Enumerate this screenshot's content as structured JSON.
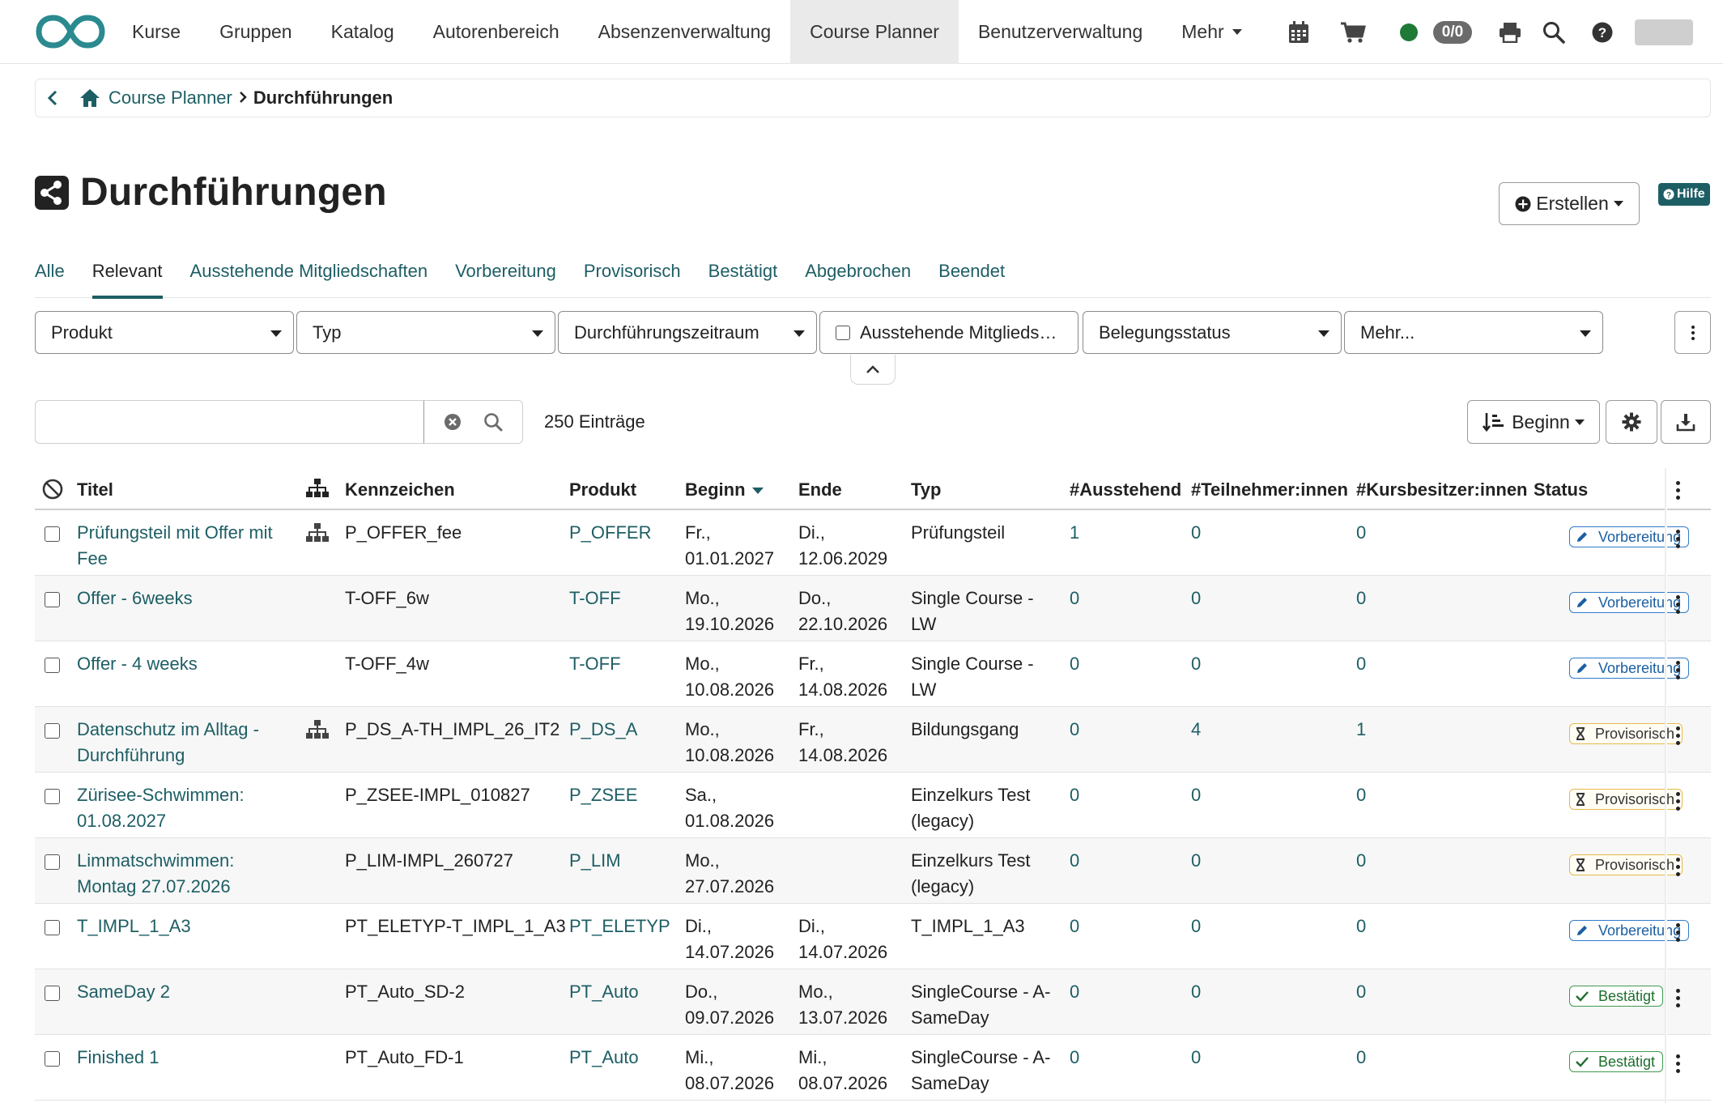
{
  "nav": {
    "items": [
      {
        "label": "Kurse"
      },
      {
        "label": "Gruppen"
      },
      {
        "label": "Katalog"
      },
      {
        "label": "Autorenbereich"
      },
      {
        "label": "Absenzenverwaltung"
      },
      {
        "label": "Course Planner",
        "active": true
      },
      {
        "label": "Benutzerverwaltung"
      },
      {
        "label": "Mehr",
        "dropdown": true
      }
    ],
    "tools": {
      "calendar_icon": "calendar-icon",
      "cart_icon": "cart-icon",
      "online_status_color": "#1e7a36",
      "counter": "0/0",
      "print_icon": "print-icon",
      "search_icon": "search-icon",
      "help_icon": "help-icon"
    }
  },
  "breadcrumb": {
    "home": "Course Planner",
    "current": "Durchführungen"
  },
  "page": {
    "title": "Durchführungen",
    "create_label": "Erstellen",
    "help_label": "Hilfe"
  },
  "tabs": [
    {
      "label": "Alle"
    },
    {
      "label": "Relevant",
      "active": true
    },
    {
      "label": "Ausstehende Mitgliedschaften"
    },
    {
      "label": "Vorbereitung"
    },
    {
      "label": "Provisorisch"
    },
    {
      "label": "Bestätigt"
    },
    {
      "label": "Abgebrochen"
    },
    {
      "label": "Beendet"
    }
  ],
  "filters": {
    "produkt": "Produkt",
    "typ": "Typ",
    "zeitraum": "Durchführungszeitraum",
    "ausstehend": "Ausstehende Mitglieds…",
    "belegung": "Belegungsstatus",
    "mehr": "Mehr..."
  },
  "search": {
    "value": "",
    "entries": "250 Einträge",
    "sort_label": "Beginn"
  },
  "table": {
    "headers": {
      "titel": "Titel",
      "kennzeichen": "Kennzeichen",
      "produkt": "Produkt",
      "beginn": "Beginn",
      "ende": "Ende",
      "typ": "Typ",
      "ausstehend": "#Ausstehend",
      "teilnehmer": "#Teilnehmer:innen",
      "kursbesitzer": "#Kursbesitzer:innen",
      "status": "Status"
    },
    "rows": [
      {
        "t1": "Prüfungsteil mit Offer mit",
        "t2": "Fee",
        "tree": true,
        "kennzeichen": "P_OFFER_fee",
        "produkt": "P_OFFER",
        "b1": "Fr.,",
        "b2": "01.01.2027",
        "e1": "Di.,",
        "e2": "12.06.2029",
        "ty1": "Prüfungsteil",
        "ty2": "",
        "ausstehend": "1",
        "teilnehmer": "0",
        "kursbesitzer": "0",
        "status": "Vorbereitung",
        "status_kind": "prep"
      },
      {
        "t1": "Offer - 6weeks",
        "t2": "",
        "tree": false,
        "kennzeichen": "T-OFF_6w",
        "produkt": "T-OFF",
        "b1": "Mo.,",
        "b2": "19.10.2026",
        "e1": "Do.,",
        "e2": "22.10.2026",
        "ty1": "Single Course -",
        "ty2": "LW",
        "ausstehend": "0",
        "teilnehmer": "0",
        "kursbesitzer": "0",
        "status": "Vorbereitung",
        "status_kind": "prep"
      },
      {
        "t1": "Offer - 4 weeks",
        "t2": "",
        "tree": false,
        "kennzeichen": "T-OFF_4w",
        "produkt": "T-OFF",
        "b1": "Mo.,",
        "b2": "10.08.2026",
        "e1": "Fr.,",
        "e2": "14.08.2026",
        "ty1": "Single Course -",
        "ty2": "LW",
        "ausstehend": "0",
        "teilnehmer": "0",
        "kursbesitzer": "0",
        "status": "Vorbereitung",
        "status_kind": "prep"
      },
      {
        "t1": "Datenschutz im Alltag -",
        "t2": "Durchführung",
        "tree": true,
        "kennzeichen": "P_DS_A-TH_IMPL_26_IT2",
        "produkt": "P_DS_A",
        "b1": "Mo.,",
        "b2": "10.08.2026",
        "e1": "Fr.,",
        "e2": "14.08.2026",
        "ty1": "Bildungsgang",
        "ty2": "",
        "ausstehend": "0",
        "teilnehmer": "4",
        "kursbesitzer": "1",
        "status": "Provisorisch",
        "status_kind": "prov"
      },
      {
        "t1": "Zürisee-Schwimmen:",
        "t2": "01.08.2027",
        "tree": false,
        "kennzeichen": "P_ZSEE-IMPL_010827",
        "produkt": "P_ZSEE",
        "b1": "Sa.,",
        "b2": "01.08.2026",
        "e1": "",
        "e2": "",
        "ty1": "Einzelkurs Test",
        "ty2": "(legacy)",
        "ausstehend": "0",
        "teilnehmer": "0",
        "kursbesitzer": "0",
        "status": "Provisorisch",
        "status_kind": "prov"
      },
      {
        "t1": "Limmatschwimmen:",
        "t2": "Montag 27.07.2026",
        "tree": false,
        "kennzeichen": "P_LIM-IMPL_260727",
        "produkt": "P_LIM",
        "b1": "Mo.,",
        "b2": "27.07.2026",
        "e1": "",
        "e2": "",
        "ty1": "Einzelkurs Test",
        "ty2": "(legacy)",
        "ausstehend": "0",
        "teilnehmer": "0",
        "kursbesitzer": "0",
        "status": "Provisorisch",
        "status_kind": "prov"
      },
      {
        "t1": "T_IMPL_1_A3",
        "t2": "",
        "tree": false,
        "kennzeichen": "PT_ELETYP-T_IMPL_1_A3",
        "produkt": "PT_ELETYP",
        "b1": "Di.,",
        "b2": "14.07.2026",
        "e1": "Di.,",
        "e2": "14.07.2026",
        "ty1": "T_IMPL_1_A3",
        "ty2": "",
        "ausstehend": "0",
        "teilnehmer": "0",
        "kursbesitzer": "0",
        "status": "Vorbereitung",
        "status_kind": "prep"
      },
      {
        "t1": "SameDay 2",
        "t2": "",
        "tree": false,
        "kennzeichen": "PT_Auto_SD-2",
        "produkt": "PT_Auto",
        "b1": "Do.,",
        "b2": "09.07.2026",
        "e1": "Mo.,",
        "e2": "13.07.2026",
        "ty1": "SingleCourse - A-",
        "ty2": "SameDay",
        "ausstehend": "0",
        "teilnehmer": "0",
        "kursbesitzer": "0",
        "status": "Bestätigt",
        "status_kind": "conf"
      },
      {
        "t1": "Finished 1",
        "t2": "",
        "tree": false,
        "kennzeichen": "PT_Auto_FD-1",
        "produkt": "PT_Auto",
        "b1": "Mi.,",
        "b2": "08.07.2026",
        "e1": "Mi.,",
        "e2": "08.07.2026",
        "ty1": "SingleCourse - A-",
        "ty2": "SameDay",
        "ausstehend": "0",
        "teilnehmer": "0",
        "kursbesitzer": "0",
        "status": "Bestätigt",
        "status_kind": "conf"
      }
    ]
  },
  "colors": {
    "accent": "#1d5e64",
    "status_prep": "#2f7bc8",
    "status_prov": "#e6b94a",
    "status_conf": "#3f9a4f"
  }
}
